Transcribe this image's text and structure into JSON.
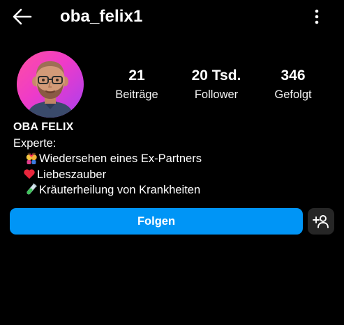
{
  "header": {
    "username": "oba_felix1",
    "back_icon": "arrow-left-icon",
    "more_icon": "more-vertical-icon"
  },
  "profile": {
    "avatar_icon": "memoji-avatar",
    "display_name": "OBA FELIX",
    "stats": [
      {
        "value": "21",
        "label": "Beiträge"
      },
      {
        "value": "20 Tsd.",
        "label": "Follower"
      },
      {
        "value": "346",
        "label": "Gefolgt"
      }
    ],
    "bio": {
      "intro": "Experte:",
      "lines": [
        {
          "icon": "couple-kiss-emoji",
          "text": "Wiedersehen eines Ex-Partners"
        },
        {
          "icon": "red-heart-emoji",
          "text": "Liebeszauber"
        },
        {
          "icon": "test-tube-emoji",
          "text": "Kräuterheilung von Krankheiten"
        }
      ]
    }
  },
  "actions": {
    "follow_label": "Folgen",
    "suggest_icon": "add-person-icon"
  },
  "colors": {
    "background": "#000000",
    "follow_button": "#0095f6",
    "secondary_button": "#262626",
    "text": "#ffffff"
  }
}
